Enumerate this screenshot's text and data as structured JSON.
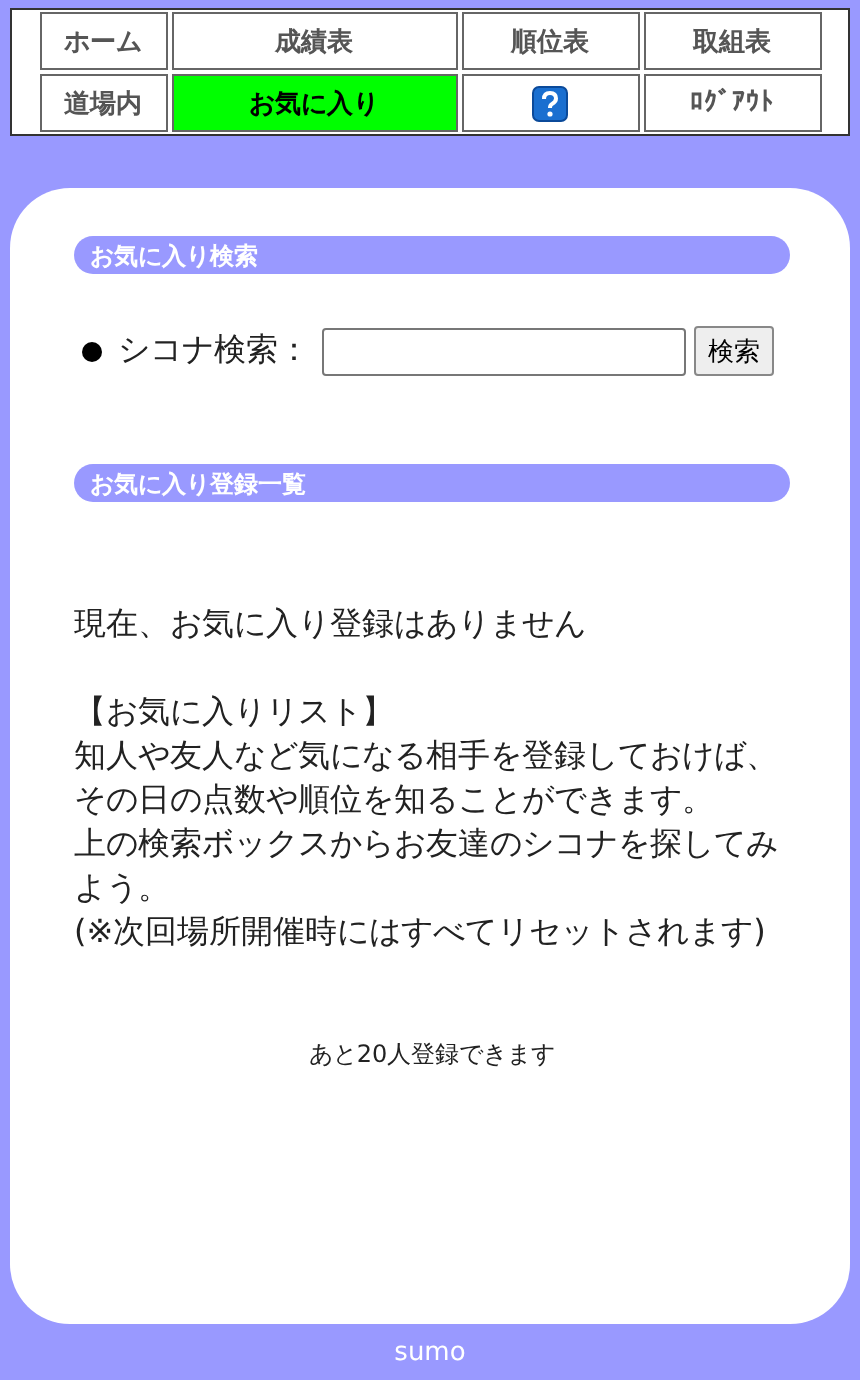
{
  "nav": {
    "rows": [
      [
        {
          "kind": "text",
          "label": "ホーム",
          "selected": false
        },
        {
          "kind": "text",
          "label": "成績表",
          "selected": false
        },
        {
          "kind": "text",
          "label": "順位表",
          "selected": false
        },
        {
          "kind": "text",
          "label": "取組表",
          "selected": false
        }
      ],
      [
        {
          "kind": "text",
          "label": "道場内",
          "selected": false
        },
        {
          "kind": "text",
          "label": "お気に入り",
          "selected": true
        },
        {
          "kind": "help",
          "selected": false
        },
        {
          "kind": "text",
          "label": "ﾛｸﾞｱｳﾄ",
          "selected": false
        }
      ]
    ]
  },
  "search_section": {
    "heading": "お気に入り検索",
    "label": "シコナ検索：",
    "button": "検索"
  },
  "list_section": {
    "heading": "お気に入り登録一覧",
    "empty_message": "現在、お気に入り登録はありません",
    "info_lines": [
      "【お気に入りリスト】",
      "知人や友人など気になる相手を登録しておけば、",
      "その日の点数や順位を知ることができます。",
      "上の検索ボックスからお友達のシコナを探してみよう。",
      "(※次回場所開催時にはすべてリセットされます)"
    ],
    "remaining": "あと20人登録できます"
  },
  "footer": "sumo"
}
